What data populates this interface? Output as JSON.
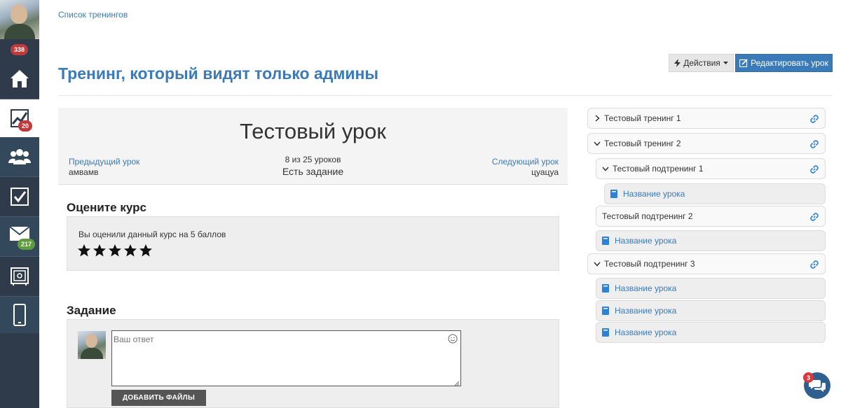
{
  "sidebar": {
    "avatar_badge": "338",
    "items": [
      {
        "name": "home",
        "badge": ""
      },
      {
        "name": "trainings",
        "badge": "20"
      },
      {
        "name": "users",
        "badge": ""
      },
      {
        "name": "tasks",
        "badge": ""
      },
      {
        "name": "messages",
        "badge": "217"
      },
      {
        "name": "safe",
        "badge": ""
      },
      {
        "name": "mobile",
        "badge": ""
      }
    ]
  },
  "breadcrumb": "Список тренингов",
  "page_title": "Тренинг, который видят только админы",
  "toolbar": {
    "actions_label": "Действия",
    "edit_label": "Редактировать урок"
  },
  "lesson": {
    "title": "Тестовый урок",
    "prev_label": "Предыдущий урок",
    "prev_name": "амвамв",
    "next_label": "Следующий урок",
    "next_name": "цуацуа",
    "counter": "8 из 25 уроков",
    "has_task": "Есть задание"
  },
  "rating": {
    "title": "Оцените курс",
    "text": "Вы оценили данный курс на 5 баллов",
    "stars": 5,
    "max_stars": 5
  },
  "task": {
    "title": "Задание",
    "placeholder": "Ваш ответ",
    "add_files_label": "ДОБАВИТЬ ФАЙЛЫ"
  },
  "tree": [
    {
      "label": "Тестовый тренинг 1",
      "type": "training",
      "expanded": false,
      "level": 0
    },
    {
      "label": "Тестовый тренинг 2",
      "type": "training",
      "expanded": true,
      "level": 0
    },
    {
      "label": "Тестовый подтренинг 1",
      "type": "training",
      "expanded": true,
      "level": 1
    },
    {
      "label": "Название урока",
      "type": "lesson",
      "level": 2
    },
    {
      "label": "Тестовый подтренинг 2",
      "type": "training",
      "expanded": null,
      "level": 1
    },
    {
      "label": "Название урока",
      "type": "lesson",
      "level": 1
    },
    {
      "label": "Тестовый подтренинг 3",
      "type": "training",
      "expanded": true,
      "level": 0
    },
    {
      "label": "Название урока",
      "type": "lesson",
      "level": 1
    },
    {
      "label": "Название урока",
      "type": "lesson",
      "level": 1
    },
    {
      "label": "Название урока",
      "type": "lesson",
      "level": 1
    }
  ],
  "chat": {
    "badge": "3"
  },
  "colors": {
    "accent": "#3a7ab8",
    "sidebar": "#2f3b4a",
    "badge_red": "#c0393b",
    "badge_green": "#5f9c3d"
  }
}
